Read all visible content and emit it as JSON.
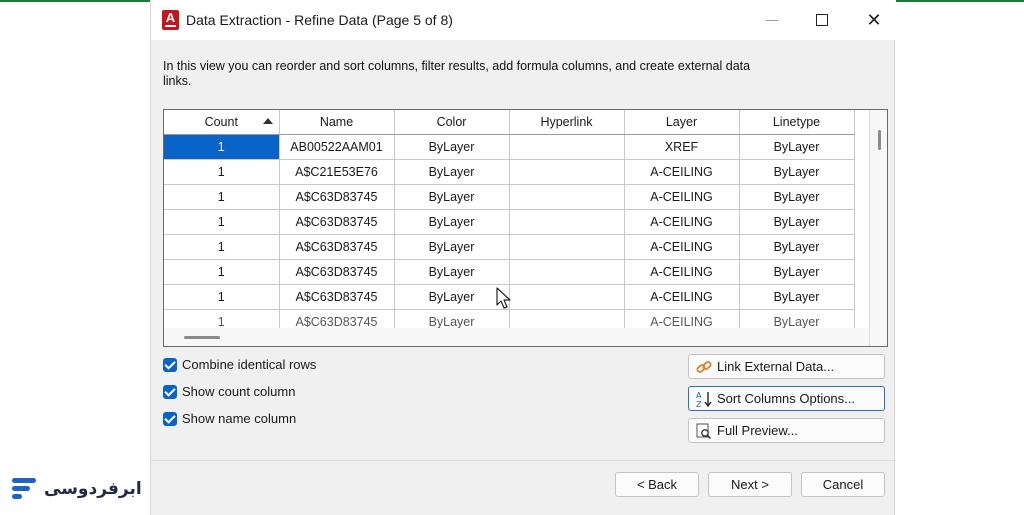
{
  "window": {
    "title": "Data Extraction - Refine Data (Page 5 of 8)",
    "app_icon_letter": "A"
  },
  "intro_text": "In this view you can reorder and sort columns, filter results, add formula columns, and create external data links.",
  "grid": {
    "columns": [
      "Count",
      "Name",
      "Color",
      "Hyperlink",
      "Layer",
      "Linetype"
    ],
    "sorted_column": "Count",
    "sort_direction": "ascending",
    "rows": [
      [
        "1",
        "AB00522AAM01",
        "ByLayer",
        "",
        "XREF",
        "ByLayer"
      ],
      [
        "1",
        "A$C21E53E76",
        "ByLayer",
        "",
        "A-CEILING",
        "ByLayer"
      ],
      [
        "1",
        "A$C63D83745",
        "ByLayer",
        "",
        "A-CEILING",
        "ByLayer"
      ],
      [
        "1",
        "A$C63D83745",
        "ByLayer",
        "",
        "A-CEILING",
        "ByLayer"
      ],
      [
        "1",
        "A$C63D83745",
        "ByLayer",
        "",
        "A-CEILING",
        "ByLayer"
      ],
      [
        "1",
        "A$C63D83745",
        "ByLayer",
        "",
        "A-CEILING",
        "ByLayer"
      ],
      [
        "1",
        "A$C63D83745",
        "ByLayer",
        "",
        "A-CEILING",
        "ByLayer"
      ]
    ],
    "partial_row": [
      "1",
      "A$C63D83745",
      "ByLayer",
      "",
      "A-CEILING",
      "ByLayer"
    ],
    "selected_cell": "row 1, Count"
  },
  "options": {
    "combine_rows": {
      "label": "Combine identical rows",
      "checked": true
    },
    "show_count": {
      "label": "Show count column",
      "checked": true
    },
    "show_name": {
      "label": "Show name column",
      "checked": true
    }
  },
  "side_buttons": {
    "link_external": "Link External Data...",
    "sort_columns": "Sort Columns Options...",
    "full_preview": "Full Preview..."
  },
  "nav_buttons": {
    "back": "< Back",
    "next": "Next >",
    "cancel": "Cancel"
  },
  "branding": {
    "logo_text": "ابرفردوسی",
    "accent_color": "#1e63c6"
  },
  "colors": {
    "selection": "#0a64c8",
    "checkbox": "#0a64c8",
    "titlebar_accent": "#1f7a38",
    "autocad_icon": "#c4161c"
  }
}
